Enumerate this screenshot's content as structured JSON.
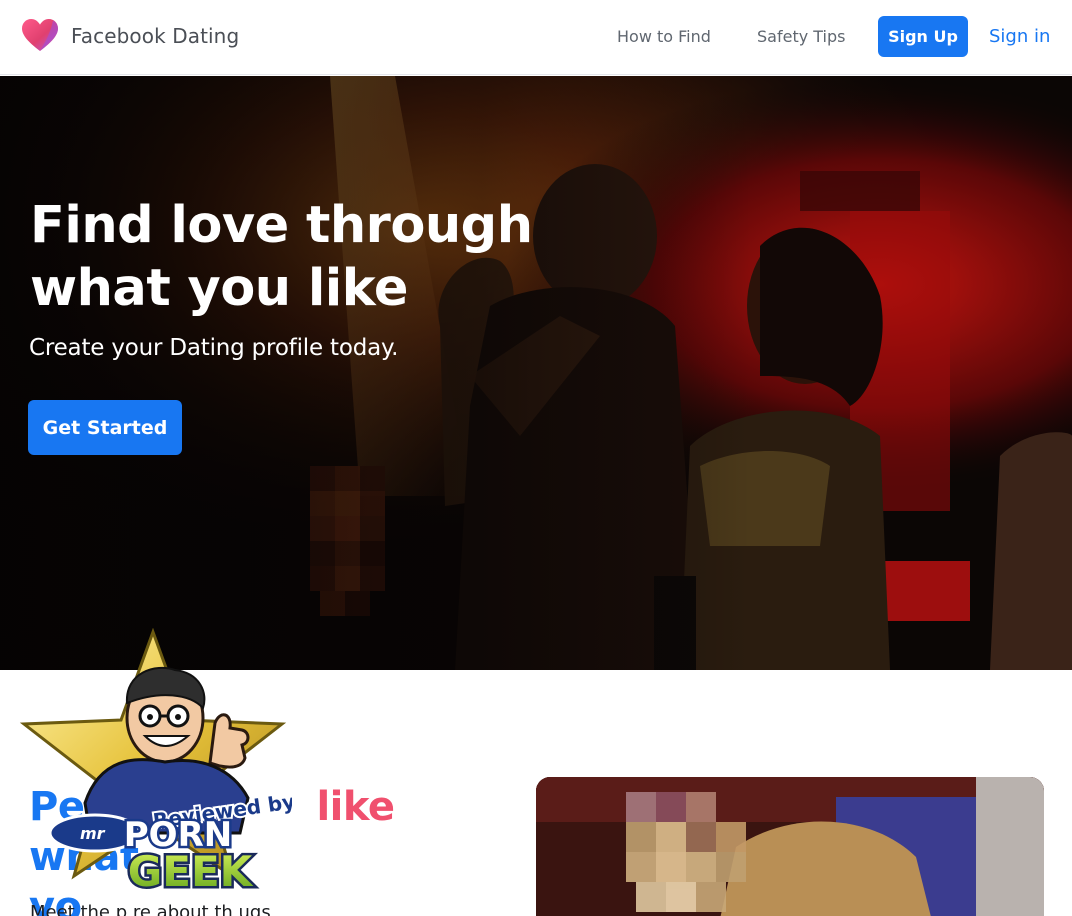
{
  "header": {
    "brand": "Facebook Dating",
    "nav": [
      "How to Find",
      "Safety Tips"
    ],
    "signup_label": "Sign Up",
    "signin_label": "Sign in",
    "logo_icon": "heart-icon"
  },
  "hero": {
    "title_line1": "Find love through",
    "title_line2": "what you like",
    "subtitle": "Create your Dating profile today.",
    "cta_label": "Get Started"
  },
  "section2": {
    "heading_start": "Pe",
    "heading_highlight": "like",
    "heading_mid": " what",
    "heading_line2": "yo",
    "body_fragment": "Meet the p                    re about th  ugs"
  },
  "badge": {
    "line1": "Reviewed by",
    "line2": "mr",
    "line3": "PORN",
    "line4": "GEEK"
  },
  "colors": {
    "brand_blue": "#1877f2",
    "accent_pink": "#f0506e",
    "heading_gray": "#4b4f56"
  }
}
